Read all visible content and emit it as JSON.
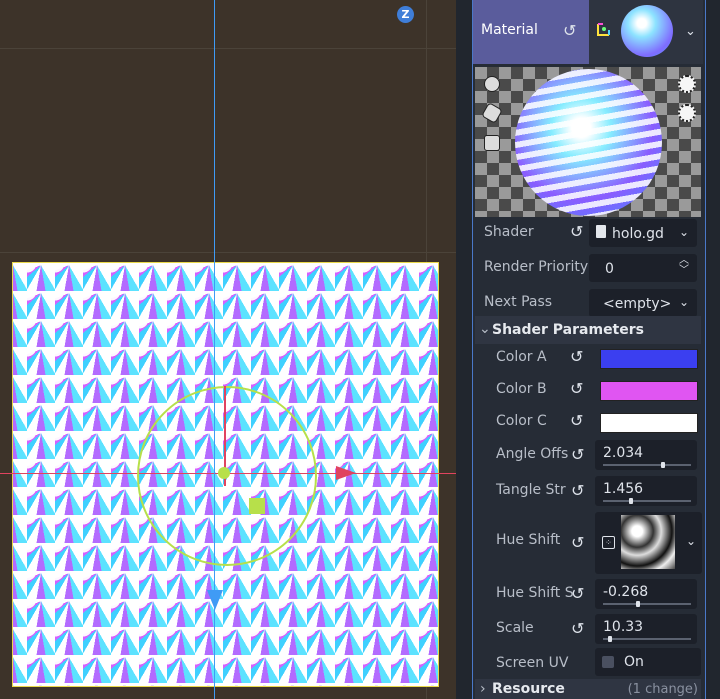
{
  "viewport": {
    "z_axis_badge": "Z"
  },
  "inspector": {
    "material": {
      "label": "Material",
      "revert_icon": "revert-icon",
      "type_icon": "shader-material-icon",
      "dropdown_icon": "chevron-down-icon"
    },
    "shader": {
      "label": "Shader",
      "value": "holo.gd"
    },
    "render_priority": {
      "label": "Render Priority",
      "value": "0"
    },
    "next_pass": {
      "label": "Next Pass",
      "value": "<empty>"
    },
    "shader_parameters": {
      "title": "Shader Parameters",
      "params": [
        {
          "label": "Color A",
          "color": "#3b3ff0"
        },
        {
          "label": "Color B",
          "color": "#e055f2"
        },
        {
          "label": "Color C",
          "color": "#ffffff"
        },
        {
          "label": "Angle Offs",
          "value": "2.034",
          "fraction": 0.68
        },
        {
          "label": "Tangle Str",
          "value": "1.456",
          "fraction": 0.3
        },
        {
          "label": "Hue Shift",
          "texture": "noise-texture"
        },
        {
          "label": "Hue Shift S",
          "value": "-0.268",
          "fraction": 0.38
        },
        {
          "label": "Scale",
          "value": "10.33",
          "fraction": 0.06
        },
        {
          "label": "Screen UV",
          "value": "On",
          "checked": false
        }
      ]
    },
    "resource": {
      "title": "Resource",
      "changes": "(1 change)"
    }
  },
  "colors": {
    "viewport_bg": "#3d3329",
    "x_axis": "#e0445f",
    "z_axis": "#3f9bf5",
    "gizmo": "#b7e04a",
    "selection": "#e9d84a",
    "accent": "#4a78c8"
  }
}
